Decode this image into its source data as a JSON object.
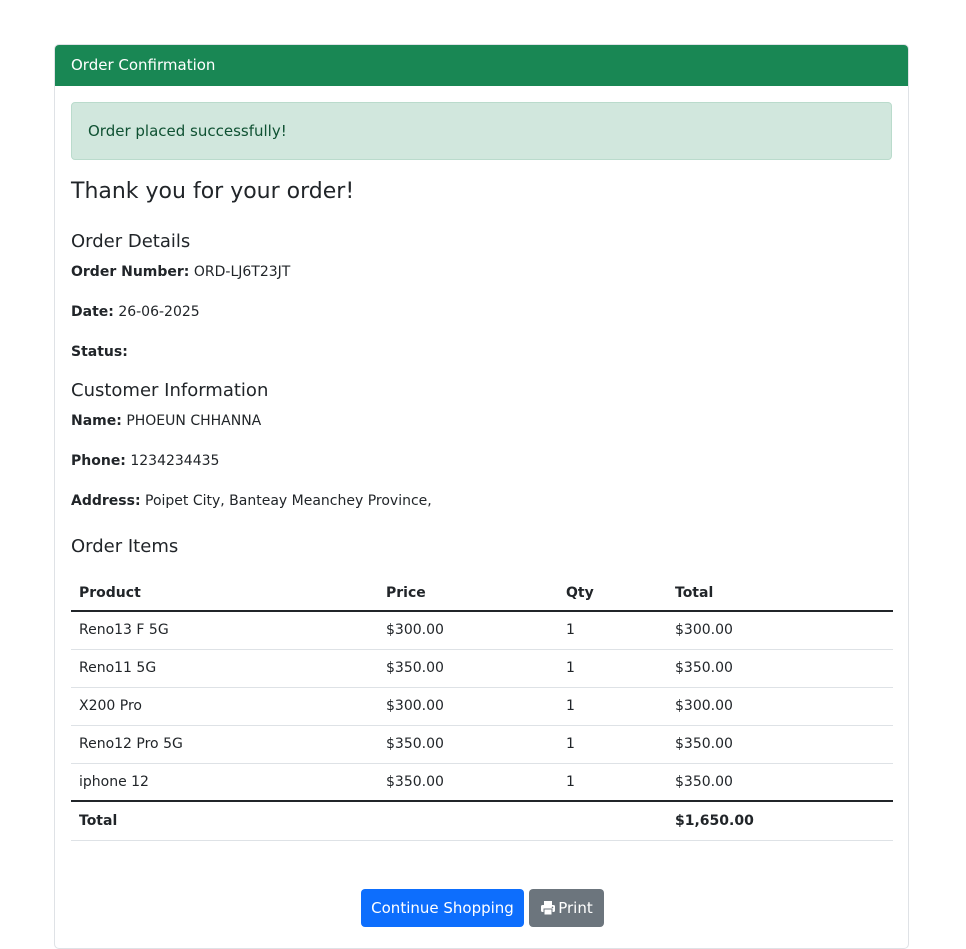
{
  "header": {
    "title": "Order Confirmation"
  },
  "alert": {
    "message": "Order placed successfully!"
  },
  "heading": "Thank you for your order!",
  "order_details": {
    "title": "Order Details",
    "order_number_label": "Order Number:",
    "order_number": "ORD-LJ6T23JT",
    "date_label": "Date:",
    "date": "26-06-2025",
    "status_label": "Status:",
    "status": ""
  },
  "customer": {
    "title": "Customer Information",
    "name_label": "Name:",
    "name": "PHOEUN CHHANNA",
    "phone_label": "Phone:",
    "phone": "1234234435",
    "address_label": "Address:",
    "address": "Poipet City, Banteay Meanchey Province,"
  },
  "items": {
    "title": "Order Items",
    "columns": [
      "Product",
      "Price",
      "Qty",
      "Total"
    ],
    "rows": [
      {
        "product": "Reno13 F 5G",
        "price": "$300.00",
        "qty": "1",
        "total": "$300.00"
      },
      {
        "product": "Reno11 5G",
        "price": "$350.00",
        "qty": "1",
        "total": "$350.00"
      },
      {
        "product": "X200 Pro",
        "price": "$300.00",
        "qty": "1",
        "total": "$300.00"
      },
      {
        "product": "Reno12 Pro 5G",
        "price": "$350.00",
        "qty": "1",
        "total": "$350.00"
      },
      {
        "product": "iphone 12",
        "price": "$350.00",
        "qty": "1",
        "total": "$350.00"
      }
    ],
    "total_label": "Total",
    "grand_total": "$1,650.00"
  },
  "actions": {
    "continue_label": "Continue Shopping",
    "print_label": "Print",
    "print_icon": "print-icon"
  },
  "colors": {
    "header": "#198754",
    "alert_bg": "#d1e7dd",
    "alert_text": "#0f5132",
    "primary": "#0d6efd",
    "secondary": "#6c757d"
  }
}
